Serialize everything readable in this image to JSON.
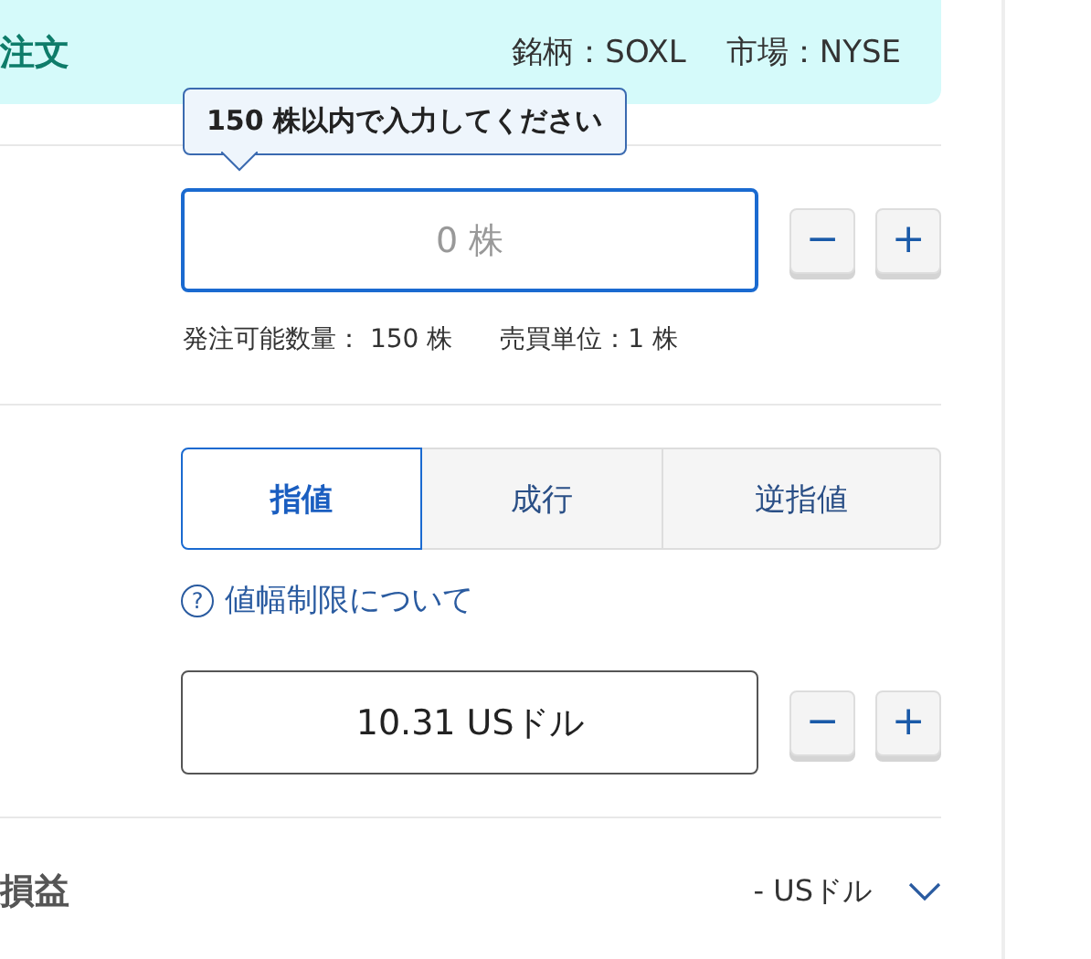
{
  "header": {
    "title": "注文",
    "symbol": "銘柄：SOXL",
    "market": "市場：NYSE"
  },
  "quantity": {
    "tooltip": "150 株以内で入力してください",
    "placeholder": "0 株",
    "focused": true,
    "decrement": "−",
    "increment": "+",
    "available": "発注可能数量： 150 株",
    "unit": "売買単位：1 株"
  },
  "order_types": [
    {
      "label": "指値",
      "selected": true
    },
    {
      "label": "成行",
      "selected": false
    },
    {
      "label": "逆指値",
      "selected": false
    }
  ],
  "price_limit_link": {
    "icon": "?",
    "label": "値幅制限について"
  },
  "price": {
    "value": "10.31 USドル",
    "focused": false,
    "decrement": "−",
    "increment": "+"
  },
  "profit_loss": {
    "label": "損益",
    "value": "- USドル",
    "expanded": false
  }
}
